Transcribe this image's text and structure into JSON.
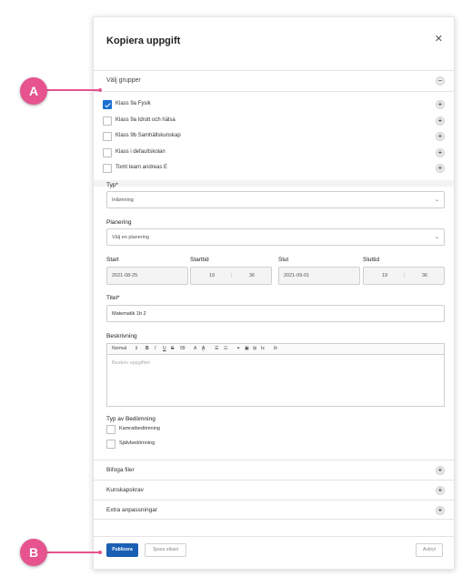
{
  "dialog": {
    "title": "Kopiera uppgift",
    "close_icon": "close-icon"
  },
  "groups": {
    "header_label": "Välj grupper",
    "collapse_symbol": "−",
    "items": [
      {
        "label": "Klass 9a Fysik",
        "checked": true
      },
      {
        "label": "Klass 9a Idrott och hälsa",
        "checked": false
      },
      {
        "label": "Klass 9b Samhällskunskap",
        "checked": false
      },
      {
        "label": "Klass i defaultskolan",
        "checked": false
      },
      {
        "label": "Tomt team andreas E",
        "checked": false
      }
    ],
    "expand_symbol": "+"
  },
  "form": {
    "typ_label": "Typ*",
    "typ_value": "Inlämning",
    "planering_label": "Planering",
    "planering_placeholder": "Välj en planering",
    "start_label": "Start",
    "start_value": "2021-08-25",
    "starttid_label": "Starttid",
    "starttid_hour": "19",
    "starttid_minute": "36",
    "slut_label": "Slut",
    "slut_value": "2021-09-01",
    "sluttid_label": "Sluttid",
    "sluttid_hour": "19",
    "sluttid_minute": "36",
    "titel_label": "Titel*",
    "titel_value": "Matematik 1b 2",
    "beskrivning_label": "Beskrivning",
    "toolbar": {
      "format": "Normal",
      "bold": "B",
      "italic": "I",
      "underline": "U",
      "strike": "S",
      "quote": "99",
      "font_color": "A",
      "highlight": "A",
      "ordered_list": "☰",
      "bullet_list": "☷",
      "link": "⚭",
      "image": "▣",
      "table": "⊞",
      "clear": "Ix",
      "formula": "fx"
    },
    "beskrivning_placeholder": "Beskriv uppgiften",
    "bedomning_label": "Typ av Bedömning",
    "bedomning_options": [
      "Kamratbedömning",
      "Självbedömning"
    ]
  },
  "sections": [
    "Bifoga filer",
    "Kunskapskrav",
    "Extra anpassningar"
  ],
  "footer": {
    "publish": "Publicera",
    "save_draft": "Spara utkast",
    "cancel": "Avbryt"
  },
  "callouts": {
    "a": "A",
    "b": "B"
  },
  "colors": {
    "accent": "#1a5fb4",
    "checkbox": "#1a6fd1",
    "callout": "#e6538e"
  }
}
